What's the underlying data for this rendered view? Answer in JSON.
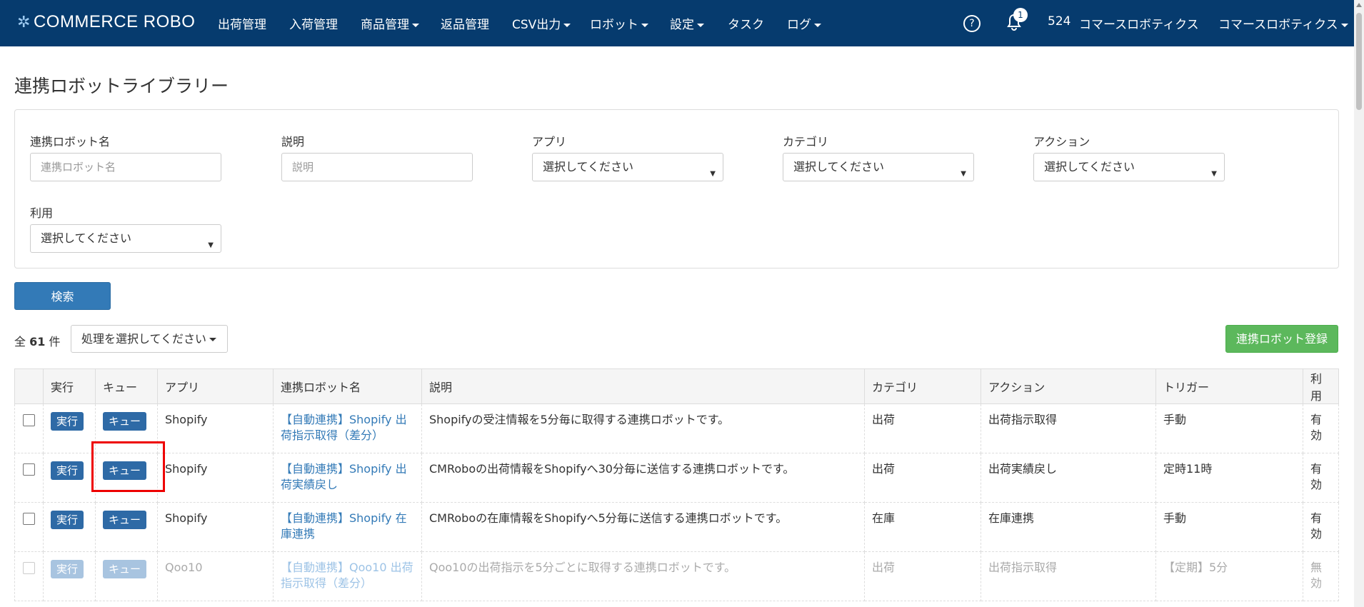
{
  "nav": {
    "logo": "COMMERCE ROBO",
    "items": [
      {
        "label": "出荷管理",
        "dropdown": false
      },
      {
        "label": "入荷管理",
        "dropdown": false
      },
      {
        "label": "商品管理",
        "dropdown": true
      },
      {
        "label": "返品管理",
        "dropdown": false
      },
      {
        "label": "CSV出力",
        "dropdown": true
      },
      {
        "label": "ロボット",
        "dropdown": true
      },
      {
        "label": "設定",
        "dropdown": true
      },
      {
        "label": "タスク",
        "dropdown": false
      },
      {
        "label": "ログ",
        "dropdown": true
      }
    ],
    "help_icon": "?",
    "notification_count": "1",
    "user_id": "524",
    "company": "コマースロボティクス",
    "user_menu": "コマースロボティクス"
  },
  "page": {
    "title": "連携ロボットライブラリー"
  },
  "filters": {
    "robot_name_label": "連携ロボット名",
    "robot_name_placeholder": "連携ロボット名",
    "description_label": "説明",
    "description_placeholder": "説明",
    "app_label": "アプリ",
    "app_value": "選択してください",
    "category_label": "カテゴリ",
    "category_value": "選択してください",
    "action_label": "アクション",
    "action_value": "選択してください",
    "usage_label": "利用",
    "usage_value": "選択してください",
    "search_button": "検索"
  },
  "toolbar": {
    "count_prefix": "全",
    "count": "61",
    "count_suffix": "件",
    "action_select": "処理を選択してください",
    "register_button": "連携ロボット登録"
  },
  "table": {
    "headers": [
      "実行",
      "キュー",
      "アプリ",
      "連携ロボット名",
      "説明",
      "カテゴリ",
      "アクション",
      "トリガー",
      "利用"
    ],
    "rows": [
      {
        "run": "実行",
        "queue": "キュー",
        "app": "Shopify",
        "name": "【自動連携】Shopify 出荷指示取得（差分）",
        "description": "Shopifyの受注情報を5分毎に取得する連携ロボットです。",
        "category": "出荷",
        "action": "出荷指示取得",
        "trigger": "手動",
        "usage": "有効",
        "disabled": false
      },
      {
        "run": "実行",
        "queue": "キュー",
        "app": "Shopify",
        "name": "【自動連携】Shopify 出荷実績戻し",
        "description": "CMRoboの出荷情報をShopifyへ30分毎に送信する連携ロボットです。",
        "category": "出荷",
        "action": "出荷実績戻し",
        "trigger": "定時11時",
        "usage": "有効",
        "disabled": false
      },
      {
        "run": "実行",
        "queue": "キュー",
        "app": "Shopify",
        "name": "【自動連携】Shopify 在庫連携",
        "description": "CMRoboの在庫情報をShopifyへ5分毎に送信する連携ロボットです。",
        "category": "在庫",
        "action": "在庫連携",
        "trigger": "手動",
        "usage": "有効",
        "disabled": false
      },
      {
        "run": "実行",
        "queue": "キュー",
        "app": "Qoo10",
        "name": "【自動連携】Qoo10 出荷指示取得（差分）",
        "description": "Qoo10の出荷指示を5分ごとに取得する連携ロボットです。",
        "category": "出荷",
        "action": "出荷指示取得",
        "trigger": "【定期】5分",
        "usage": "無効",
        "disabled": true
      }
    ]
  }
}
